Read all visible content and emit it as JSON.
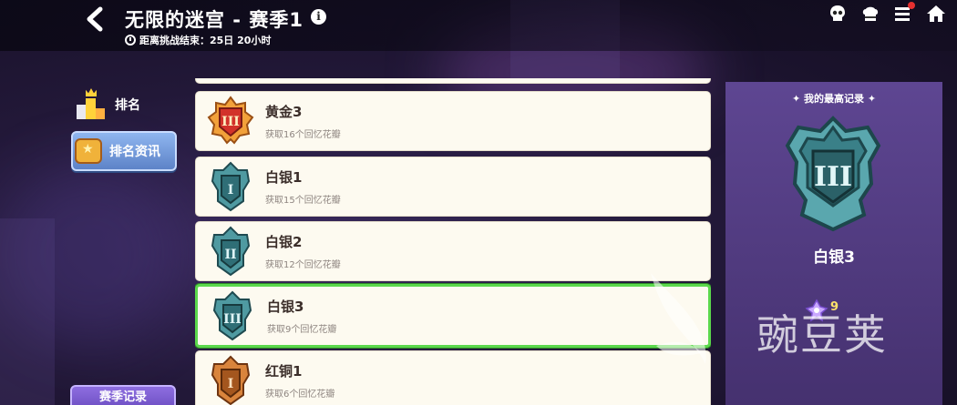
{
  "header": {
    "title": "无限的迷宫 - 赛季1",
    "countdown": "距离挑战结束：25日 20小时"
  },
  "left_nav": {
    "rank_label": "排名",
    "rank_info_label": "排名资讯",
    "season_record_label": "赛季记录"
  },
  "tiers": [
    {
      "name": "黄金3",
      "desc": "获取16个回忆花瓣",
      "badge": "gold-3"
    },
    {
      "name": "白银1",
      "desc": "获取15个回忆花瓣",
      "badge": "silver-1"
    },
    {
      "name": "白银2",
      "desc": "获取12个回忆花瓣",
      "badge": "silver-2"
    },
    {
      "name": "白银3",
      "desc": "获取9个回忆花瓣",
      "badge": "silver-3",
      "selected": true
    },
    {
      "name": "红铜1",
      "desc": "获取6个回忆花瓣",
      "badge": "bronze-1"
    }
  ],
  "best_record": {
    "title": "✦ 我的最高记录 ✦",
    "rank": "白银3",
    "petal_count": "9"
  },
  "watermark": "豌豆荚",
  "colors": {
    "selected_border": "#5bd84c",
    "gold": "#e88a2a",
    "silver": "#3f7f86",
    "bronze": "#b86b2e",
    "panel": "#5e4692"
  }
}
